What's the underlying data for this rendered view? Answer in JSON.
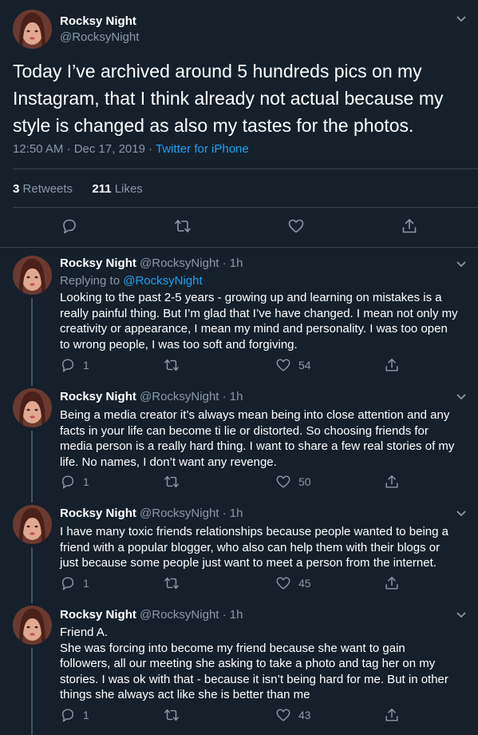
{
  "main_tweet": {
    "name": "Rocksy Night",
    "handle": "@RocksyNight",
    "text": "Today I’ve archived around 5 hundreds pics on my Instagram, that I think already not actual because my style is changed as also my tastes for the photos.",
    "timestamp": "12:50 AM · Dec 17, 2019 · ",
    "source": "Twitter for iPhone",
    "retweets_count": "3",
    "retweets_label": "Retweets",
    "likes_count": "211",
    "likes_label": "Likes"
  },
  "replies": [
    {
      "name": "Rocksy Night",
      "handle": "@RocksyNight · 1h",
      "replying_prefix": "Replying to ",
      "replying_to": "@RocksyNight",
      "text": "Looking to the past 2-5 years - growing up and learning on mistakes is a really painful thing. But I’m glad that I’ve have changed. I mean not only my creativity or appearance, I mean my mind and personality. I was too open to wrong people, I was too soft and forgiving.",
      "replies": "1",
      "likes": "54"
    },
    {
      "name": "Rocksy Night",
      "handle": "@RocksyNight · 1h",
      "text": "Being a media creator it’s always mean being into close attention and any facts in your life can become ti lie or distorted. So choosing friends for media person is a really hard thing. I want to share a few real stories of my life. No names, I don’t want any revenge.",
      "replies": "1",
      "likes": "50"
    },
    {
      "name": "Rocksy Night",
      "handle": "@RocksyNight · 1h",
      "text": "I have many toxic friends relationships because people wanted to being a friend with a popular blogger, who also can help them with their blogs or just because some people just want to meet a person from the internet.",
      "replies": "1",
      "likes": "45"
    },
    {
      "name": "Rocksy Night",
      "handle": "@RocksyNight · 1h",
      "text": "Friend A.\nShe was forcing into become my friend because she want to gain followers, all our meeting she asking to take a photo and tag her on my stories. I was ok with that - because it isn’t being hard for me. But in other things she always act like she is better than me",
      "replies": "1",
      "likes": "43"
    }
  ],
  "icons": {
    "reply": "reply-icon",
    "retweet": "retweet-icon",
    "like": "heart-icon",
    "share": "share-icon",
    "menu": "chevron-down-icon"
  },
  "colors": {
    "background": "#15202b",
    "divider": "#38444d",
    "secondary_text": "#8899a6",
    "accent": "#1da1f2"
  }
}
